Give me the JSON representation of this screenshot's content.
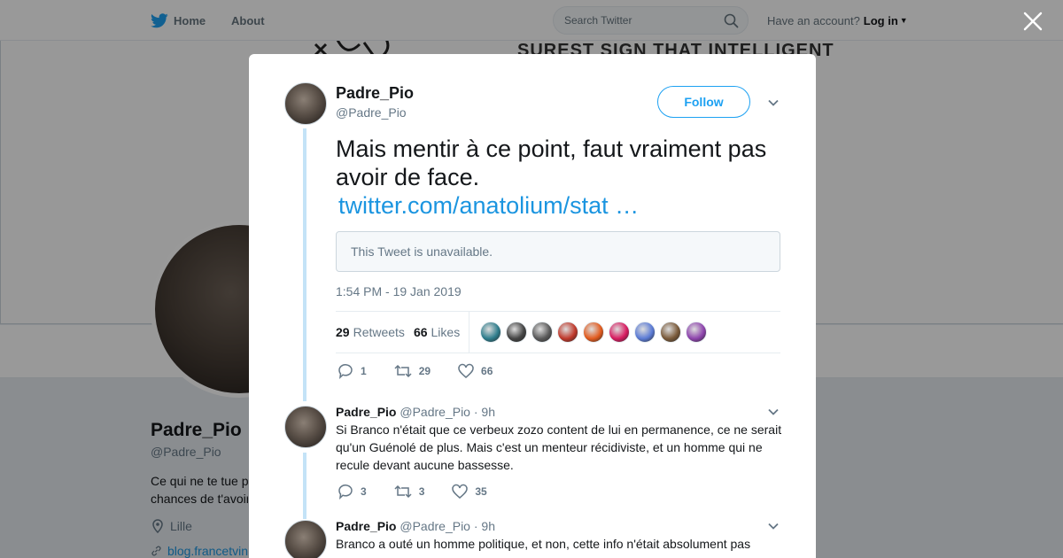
{
  "topbar": {
    "home_label": "Home",
    "about_label": "About",
    "search_placeholder": "Search Twitter",
    "have_account": "Have an account?",
    "login_label": "Log in"
  },
  "banner": {
    "text": "SUREST SIGN THAT INTELLIGENT"
  },
  "profile": {
    "name": "Padre_Pio",
    "handle": "@Padre_Pio",
    "bio": "Ce qui ne te tue p",
    "bio_line2": "chances de t'avoir",
    "location": "Lille",
    "link": "blog.francetvin"
  },
  "tweet": {
    "author_name": "Padre_Pio",
    "author_handle": "@Padre_Pio",
    "follow_label": "Follow",
    "text": "Mais mentir à ce point, faut vraiment pas avoir de face.",
    "link": "twitter.com/anatolium/stat …",
    "quote_unavailable": "This Tweet is unavailable.",
    "timestamp": "1:54 PM - 19 Jan 2019",
    "retweets_count": "29",
    "retweets_label": "Retweets",
    "likes_count": "66",
    "likes_label": "Likes",
    "likers": [
      "#2e7d8c",
      "#444444",
      "#5a5a5a",
      "#c0392b",
      "#e25b1e",
      "#d81b60",
      "#5b7bd5",
      "#7a5a3a",
      "#8e44ad"
    ],
    "actions": {
      "replies": "1",
      "retweets": "29",
      "likes": "66"
    }
  },
  "replies": [
    {
      "name": "Padre_Pio",
      "handle": "@Padre_Pio",
      "time": "· 9h",
      "text": "Si Branco n'était que ce verbeux zozo content de lui en permanence, ce ne serait qu'un Guénolé de plus. Mais c'est un menteur récidiviste, et un homme qui ne recule devant aucune bassesse.",
      "actions": {
        "replies": "3",
        "retweets": "3",
        "likes": "35"
      }
    },
    {
      "name": "Padre_Pio",
      "handle": "@Padre_Pio",
      "time": "· 9h",
      "text": "Branco a outé un homme politique, et non, cette info n'était absolument pas"
    }
  ],
  "colors": {
    "accent": "#1da1f2",
    "link": "#1b95e0",
    "thread": "#c4e3f7"
  }
}
